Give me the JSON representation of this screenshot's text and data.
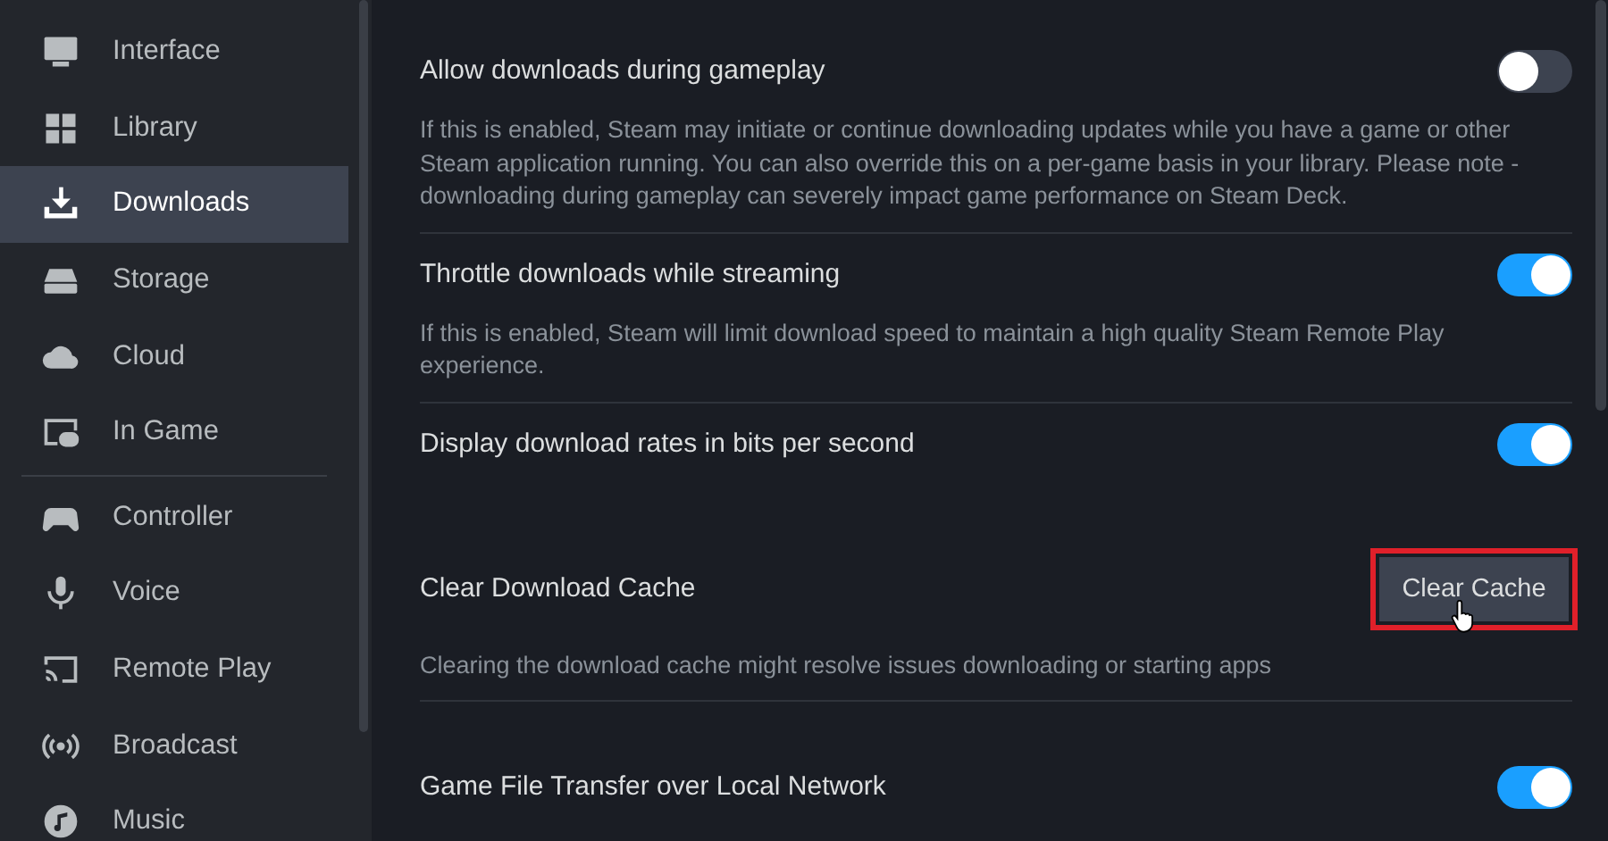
{
  "sidebar": {
    "groups": [
      {
        "items": [
          {
            "label": "Interface",
            "selected": false
          },
          {
            "label": "Library",
            "selected": false
          },
          {
            "label": "Downloads",
            "selected": true
          },
          {
            "label": "Storage",
            "selected": false
          },
          {
            "label": "Cloud",
            "selected": false
          },
          {
            "label": "In Game",
            "selected": false
          }
        ]
      },
      {
        "items": [
          {
            "label": "Controller",
            "selected": false
          },
          {
            "label": "Voice",
            "selected": false
          },
          {
            "label": "Remote Play",
            "selected": false
          },
          {
            "label": "Broadcast",
            "selected": false
          },
          {
            "label": "Music",
            "selected": false
          }
        ]
      }
    ]
  },
  "settings": [
    {
      "kind": "toggle",
      "title": "Allow downloads during gameplay",
      "on": false,
      "description": "If this is enabled, Steam may initiate or continue downloading updates while you have a game or other Steam application running. You can also override this on a per-game basis in your library. Please note - downloading during gameplay can severely impact game performance on Steam Deck.",
      "divider": true
    },
    {
      "kind": "toggle",
      "title": "Throttle downloads while streaming",
      "on": true,
      "description": "If this is enabled, Steam will limit download speed to maintain a high quality Steam Remote Play experience.",
      "divider": true
    },
    {
      "kind": "toggle",
      "title": "Display download rates in bits per second",
      "on": true,
      "divider": false
    },
    {
      "kind": "button",
      "title": "Clear Download Cache",
      "button": "Clear Cache",
      "highlighted": true,
      "description": "Clearing the download cache might resolve issues downloading or starting apps",
      "divider": true
    },
    {
      "kind": "toggle",
      "title": "Game File Transfer over Local Network",
      "on": true,
      "divider": false
    }
  ]
}
